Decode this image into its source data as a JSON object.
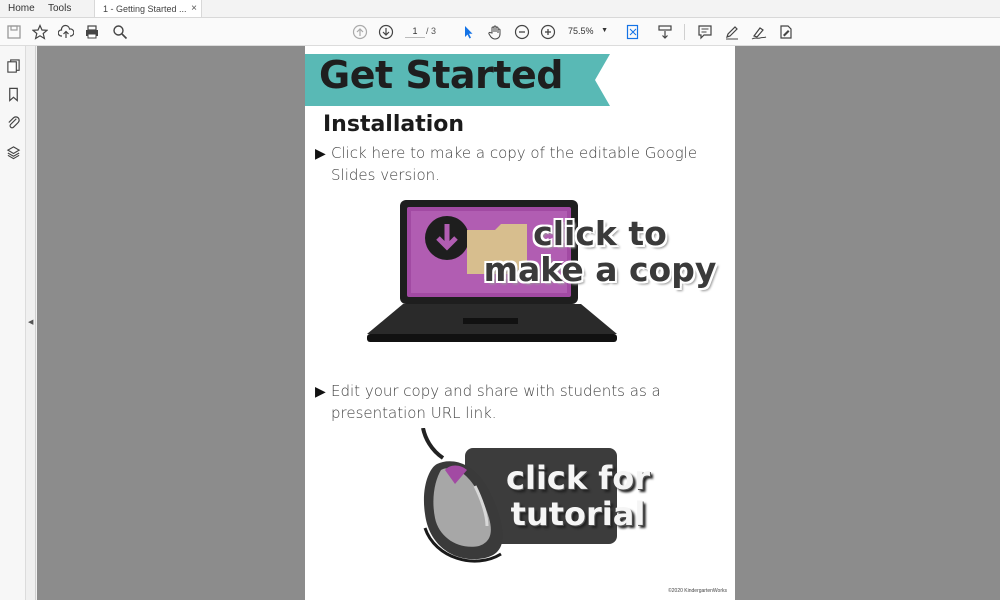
{
  "tabs": {
    "home": "Home",
    "tools": "Tools",
    "document": "1 - Getting Started ...",
    "close": "×"
  },
  "toolbar": {
    "icons": [
      "save-icon",
      "star-icon",
      "upload-icon",
      "print-icon",
      "search-icon",
      "page-up-icon",
      "page-down-icon",
      "select-icon",
      "hand-icon",
      "zoom-out-icon",
      "zoom-in-icon",
      "fit-page-icon",
      "scroll-mode-icon",
      "comment-icon",
      "highlight-icon",
      "sign-icon",
      "fill-sign-icon"
    ],
    "page_current": "1",
    "page_total": "/ 3",
    "zoom": "75.5%"
  },
  "sidebar": {
    "icons": [
      "pages-icon",
      "bookmark-icon",
      "attachment-icon",
      "layers-icon"
    ]
  },
  "document": {
    "banner_title": "Get Started",
    "heading": "Installation",
    "bullet1_line1": "Click here to make a copy of the editable Google",
    "bullet1_line2": "Slides version.",
    "copy_button_line1": "click to",
    "copy_button_line2": "make a copy",
    "bullet2_line1": "Edit your copy and share with students as a",
    "bullet2_line2": "presentation URL link.",
    "tutorial_line1": "click for",
    "tutorial_line2": "tutorial",
    "footer": "©2020 KindergartenWorks"
  },
  "colors": {
    "banner": "#59b9b5",
    "screen": "#a24aa3",
    "canvas": "#8c8c8c"
  }
}
